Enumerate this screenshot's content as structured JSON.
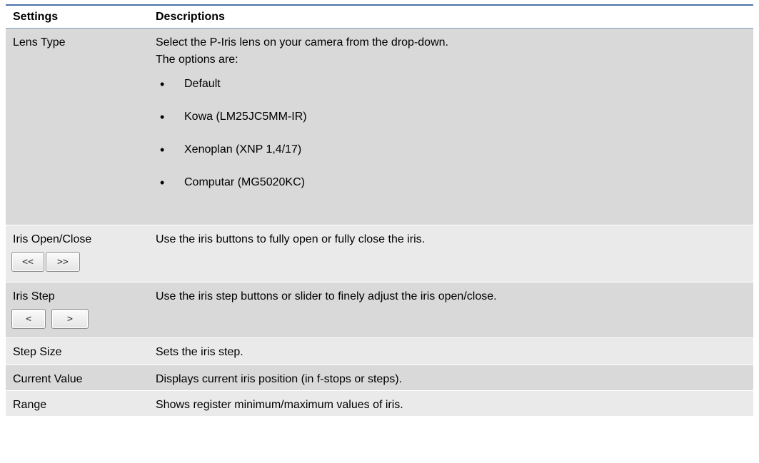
{
  "header": {
    "settings": "Settings",
    "descriptions": "Descriptions"
  },
  "rows": {
    "lens_type": {
      "setting": "Lens Type",
      "desc_line1": "Select the P-Iris lens on your camera from the drop-down.",
      "desc_line2": "The options are:",
      "options": [
        "Default",
        "Kowa (LM25JC5MM-IR)",
        "Xenoplan (XNP 1,4/17)",
        "Computar (MG5020KC)"
      ],
      "bullet": "•"
    },
    "iris_open_close": {
      "setting": "Iris Open/Close",
      "desc": "Use the iris buttons to fully open or fully close the iris.",
      "btn_open": "<<",
      "btn_close": ">>"
    },
    "iris_step": {
      "setting": "Iris Step",
      "desc": "Use the iris step buttons or slider to finely adjust the iris open/close.",
      "btn_prev": "<",
      "btn_next": ">"
    },
    "step_size": {
      "setting": "Step Size",
      "desc": "Sets the iris step."
    },
    "current_value": {
      "setting": "Current Value",
      "desc": "Displays current iris position (in f-stops or steps)."
    },
    "range": {
      "setting": "Range",
      "desc": "Shows register minimum/maximum values of iris."
    }
  }
}
